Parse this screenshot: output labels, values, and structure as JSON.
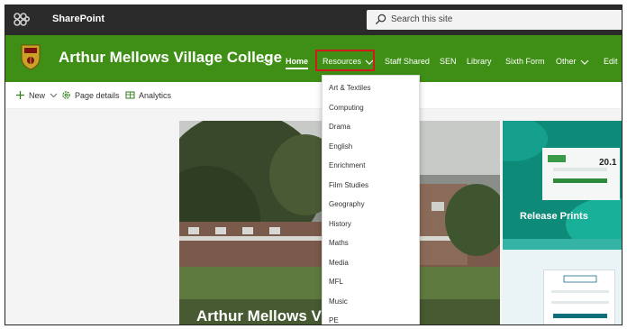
{
  "suite": {
    "app_name": "SharePoint",
    "search_placeholder": "Search this site"
  },
  "site": {
    "title": "Arthur Mellows Village College",
    "collapse_label": "<<",
    "nav": {
      "home": "Home",
      "resources": "Resources",
      "staff_shared": "Staff Shared",
      "sen": "SEN",
      "library": "Library",
      "sixth_form": "Sixth Form",
      "other": "Other",
      "edit": "Edit"
    }
  },
  "commands": {
    "new": "New",
    "page_details": "Page details",
    "analytics": "Analytics"
  },
  "resources_menu": {
    "items": [
      "Art & Textiles",
      "Computing",
      "Drama",
      "English",
      "Enrichment",
      "Film Studies",
      "Geography",
      "History",
      "Maths",
      "Media",
      "MFL",
      "Music",
      "PE"
    ]
  },
  "hero": {
    "title": "Arthur Mellows Vil"
  },
  "tiles": {
    "release_prints": "Release Prints",
    "papercut_version": "20.1"
  },
  "colors": {
    "suitebar": "#2b2b2b",
    "site_header": "#3f8f16",
    "highlight_box": "#d11a1a",
    "tile_teal": "#0d8a78"
  }
}
